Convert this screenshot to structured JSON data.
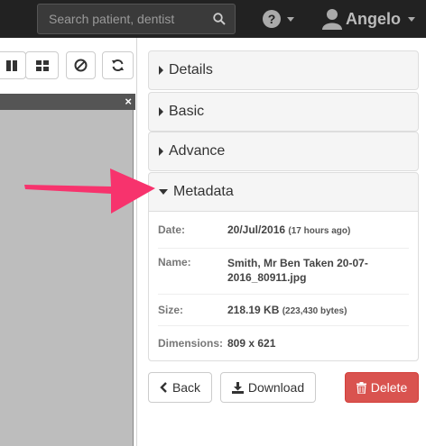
{
  "navbar": {
    "search_placeholder": "Search patient, dentist",
    "user_name": "Angelo"
  },
  "accordion": {
    "details_label": "Details",
    "basic_label": "Basic",
    "advance_label": "Advance",
    "metadata_label": "Metadata"
  },
  "metadata": {
    "date_label": "Date:",
    "date_value": "20/Jul/2016",
    "date_relative": "(17 hours ago)",
    "name_label": "Name:",
    "name_value_line1": "Smith, Mr Ben Taken 20-07-",
    "name_value_line2": "2016_80911.jpg",
    "size_label": "Size:",
    "size_value": "218.19 KB",
    "size_bytes": "(223,430 bytes)",
    "dimensions_label": "Dimensions:",
    "dimensions_value": "809 x 621"
  },
  "actions": {
    "back_label": "Back",
    "download_label": "Download",
    "delete_label": "Delete"
  },
  "viewer": {
    "close_glyph": "×"
  },
  "colors": {
    "navbar_bg": "#222222",
    "danger": "#d9534f",
    "annotation_arrow": "#f7336d",
    "viewer_bg": "#bdbdbd"
  }
}
